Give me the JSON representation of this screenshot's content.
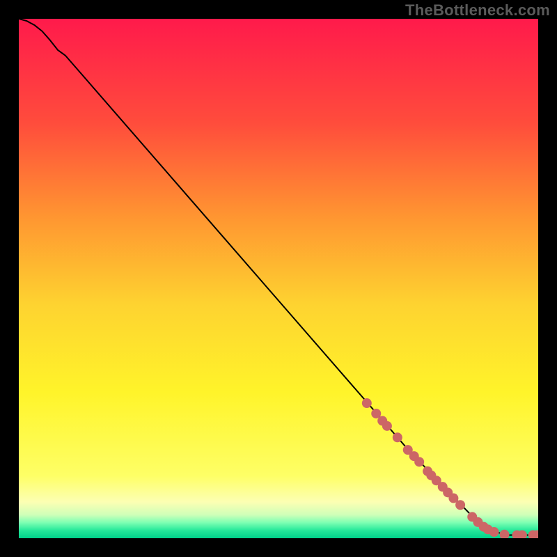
{
  "watermark": "TheBottleneck.com",
  "chart_data": {
    "type": "line",
    "title": "",
    "xlabel": "",
    "ylabel": "",
    "xlim": [
      0,
      100
    ],
    "ylim": [
      0,
      100
    ],
    "grid": false,
    "curve": [
      {
        "x": 0,
        "y": 100
      },
      {
        "x": 1.5,
        "y": 99.6
      },
      {
        "x": 3.0,
        "y": 98.8
      },
      {
        "x": 4.5,
        "y": 97.6
      },
      {
        "x": 6.0,
        "y": 95.9
      },
      {
        "x": 7.5,
        "y": 94.0
      },
      {
        "x": 9.0,
        "y": 92.9
      },
      {
        "x": 75.0,
        "y": 17.0
      },
      {
        "x": 88.0,
        "y": 3.5
      },
      {
        "x": 91.5,
        "y": 1.3
      },
      {
        "x": 94.0,
        "y": 0.6
      },
      {
        "x": 100.0,
        "y": 0.6
      }
    ],
    "marker_color": "#cc6666",
    "marker_radius_px": 7,
    "markers": [
      {
        "x": 67.0,
        "y": 26.0
      },
      {
        "x": 68.8,
        "y": 24.0
      },
      {
        "x": 70.0,
        "y": 22.6
      },
      {
        "x": 70.9,
        "y": 21.6
      },
      {
        "x": 72.9,
        "y": 19.4
      },
      {
        "x": 74.9,
        "y": 17.0
      },
      {
        "x": 76.1,
        "y": 15.8
      },
      {
        "x": 77.1,
        "y": 14.7
      },
      {
        "x": 78.7,
        "y": 12.9
      },
      {
        "x": 79.4,
        "y": 12.1
      },
      {
        "x": 80.4,
        "y": 11.1
      },
      {
        "x": 81.6,
        "y": 9.9
      },
      {
        "x": 82.6,
        "y": 8.8
      },
      {
        "x": 83.7,
        "y": 7.7
      },
      {
        "x": 85.0,
        "y": 6.4
      },
      {
        "x": 87.3,
        "y": 4.1
      },
      {
        "x": 88.4,
        "y": 3.1
      },
      {
        "x": 89.5,
        "y": 2.2
      },
      {
        "x": 90.3,
        "y": 1.7
      },
      {
        "x": 91.5,
        "y": 1.2
      },
      {
        "x": 93.5,
        "y": 0.7
      },
      {
        "x": 95.9,
        "y": 0.6
      },
      {
        "x": 96.9,
        "y": 0.6
      },
      {
        "x": 99.0,
        "y": 0.6
      },
      {
        "x": 99.8,
        "y": 0.6
      }
    ],
    "gradient_stops": [
      {
        "offset": 0,
        "color": "#ff1a4b"
      },
      {
        "offset": 20,
        "color": "#ff4c3c"
      },
      {
        "offset": 38,
        "color": "#ff9531"
      },
      {
        "offset": 55,
        "color": "#fed330"
      },
      {
        "offset": 72,
        "color": "#fff42a"
      },
      {
        "offset": 88,
        "color": "#feff66"
      },
      {
        "offset": 93,
        "color": "#fcffb3"
      },
      {
        "offset": 95.5,
        "color": "#cfffb8"
      },
      {
        "offset": 97,
        "color": "#7dffb3"
      },
      {
        "offset": 98.5,
        "color": "#25e89a"
      },
      {
        "offset": 100,
        "color": "#00d08a"
      }
    ]
  }
}
